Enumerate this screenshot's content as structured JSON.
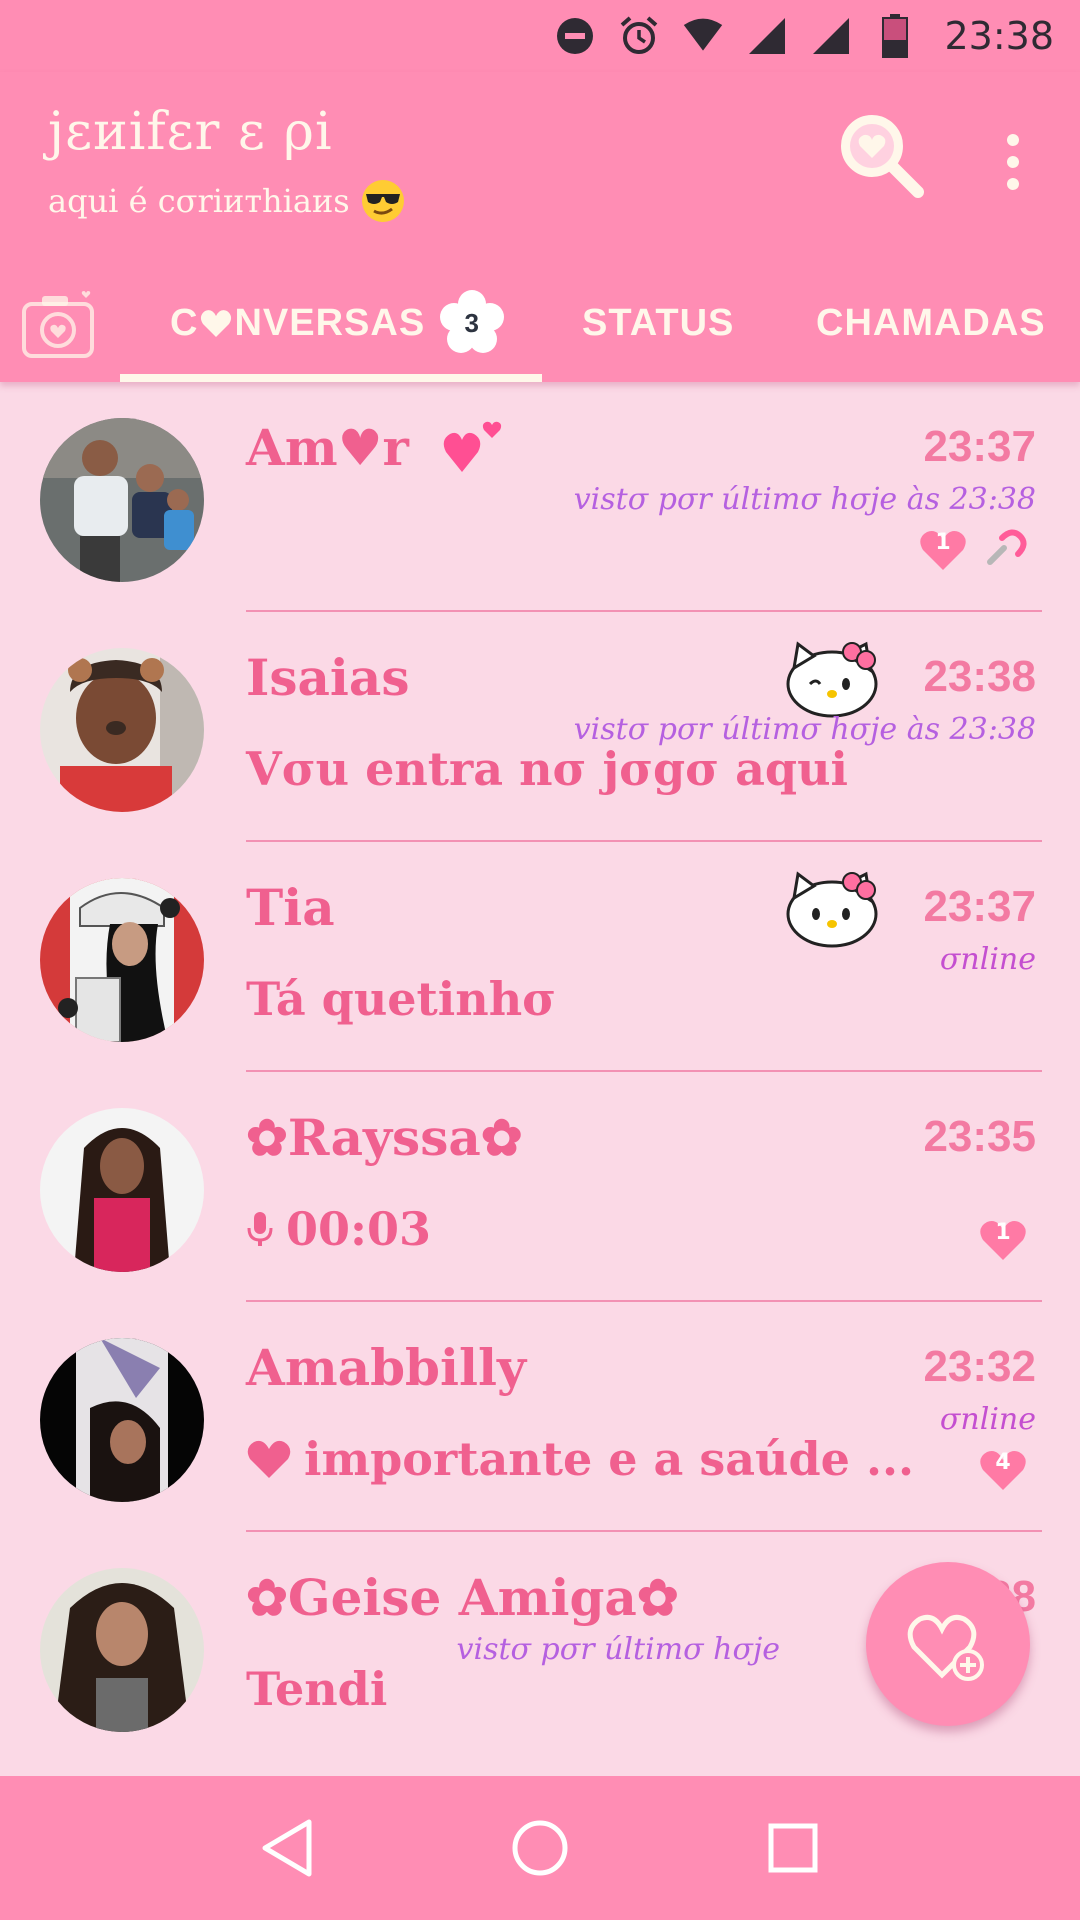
{
  "status_bar": {
    "time": "23:38",
    "icons": [
      "do-not-disturb-icon",
      "alarm-icon",
      "wifi-icon",
      "signal-icon",
      "signal-icon-2",
      "battery-icon"
    ]
  },
  "header": {
    "title": "jɛиifɛr ɛ ρi",
    "subtitle": "aqui é cσriитhiaиs",
    "subtitle_emoji": "sunglasses-emoji"
  },
  "tabs": {
    "chats_prefix": "C",
    "chats_suffix": "NVERSAS",
    "chats_badge": "3",
    "status": "STATUS",
    "calls": "CHAMADAS"
  },
  "colors": {
    "header_bg": "#ff8db4",
    "list_bg": "#fbd9e6",
    "name_pink": "#f0608f",
    "time_pink": "#f37aa2",
    "last_seen_purple": "#b560e0",
    "cream": "#fff7ea"
  },
  "chats": [
    {
      "name": "Am♥r",
      "time": "23:37",
      "last_seen": "vistσ pσr últimσ hσje às 23:38",
      "message": "",
      "unread": "1",
      "pinned": true
    },
    {
      "name": "Isaias",
      "time": "23:38",
      "last_seen": "vistσ pσr últimσ hσje às 23:38",
      "message": "Vσu entra nσ jσgσ aqui",
      "sticker": "hello-kitty"
    },
    {
      "name": "Tia",
      "time": "23:37",
      "online": "σnline",
      "message": "Tá quetinhσ",
      "sticker": "hello-kitty"
    },
    {
      "name": "✿Rayssa✿",
      "time": "23:35",
      "message": "00:03",
      "message_icon": "microphone-icon",
      "unread": "1"
    },
    {
      "name": "Amabbilly",
      "time": "23:32",
      "online": "σnline",
      "message": "importante e a saúde ...",
      "message_icon": "heart-icon",
      "unread": "4"
    },
    {
      "name": "✿Geise Amiga✿",
      "time": "23:38",
      "last_seen": "vistσ pσr últimσ hσje",
      "message": "Tendi"
    }
  ],
  "fab": {
    "icon": "new-chat-heart-icon"
  },
  "nav": {
    "icons": [
      "back-icon",
      "home-icon",
      "recents-icon"
    ]
  }
}
